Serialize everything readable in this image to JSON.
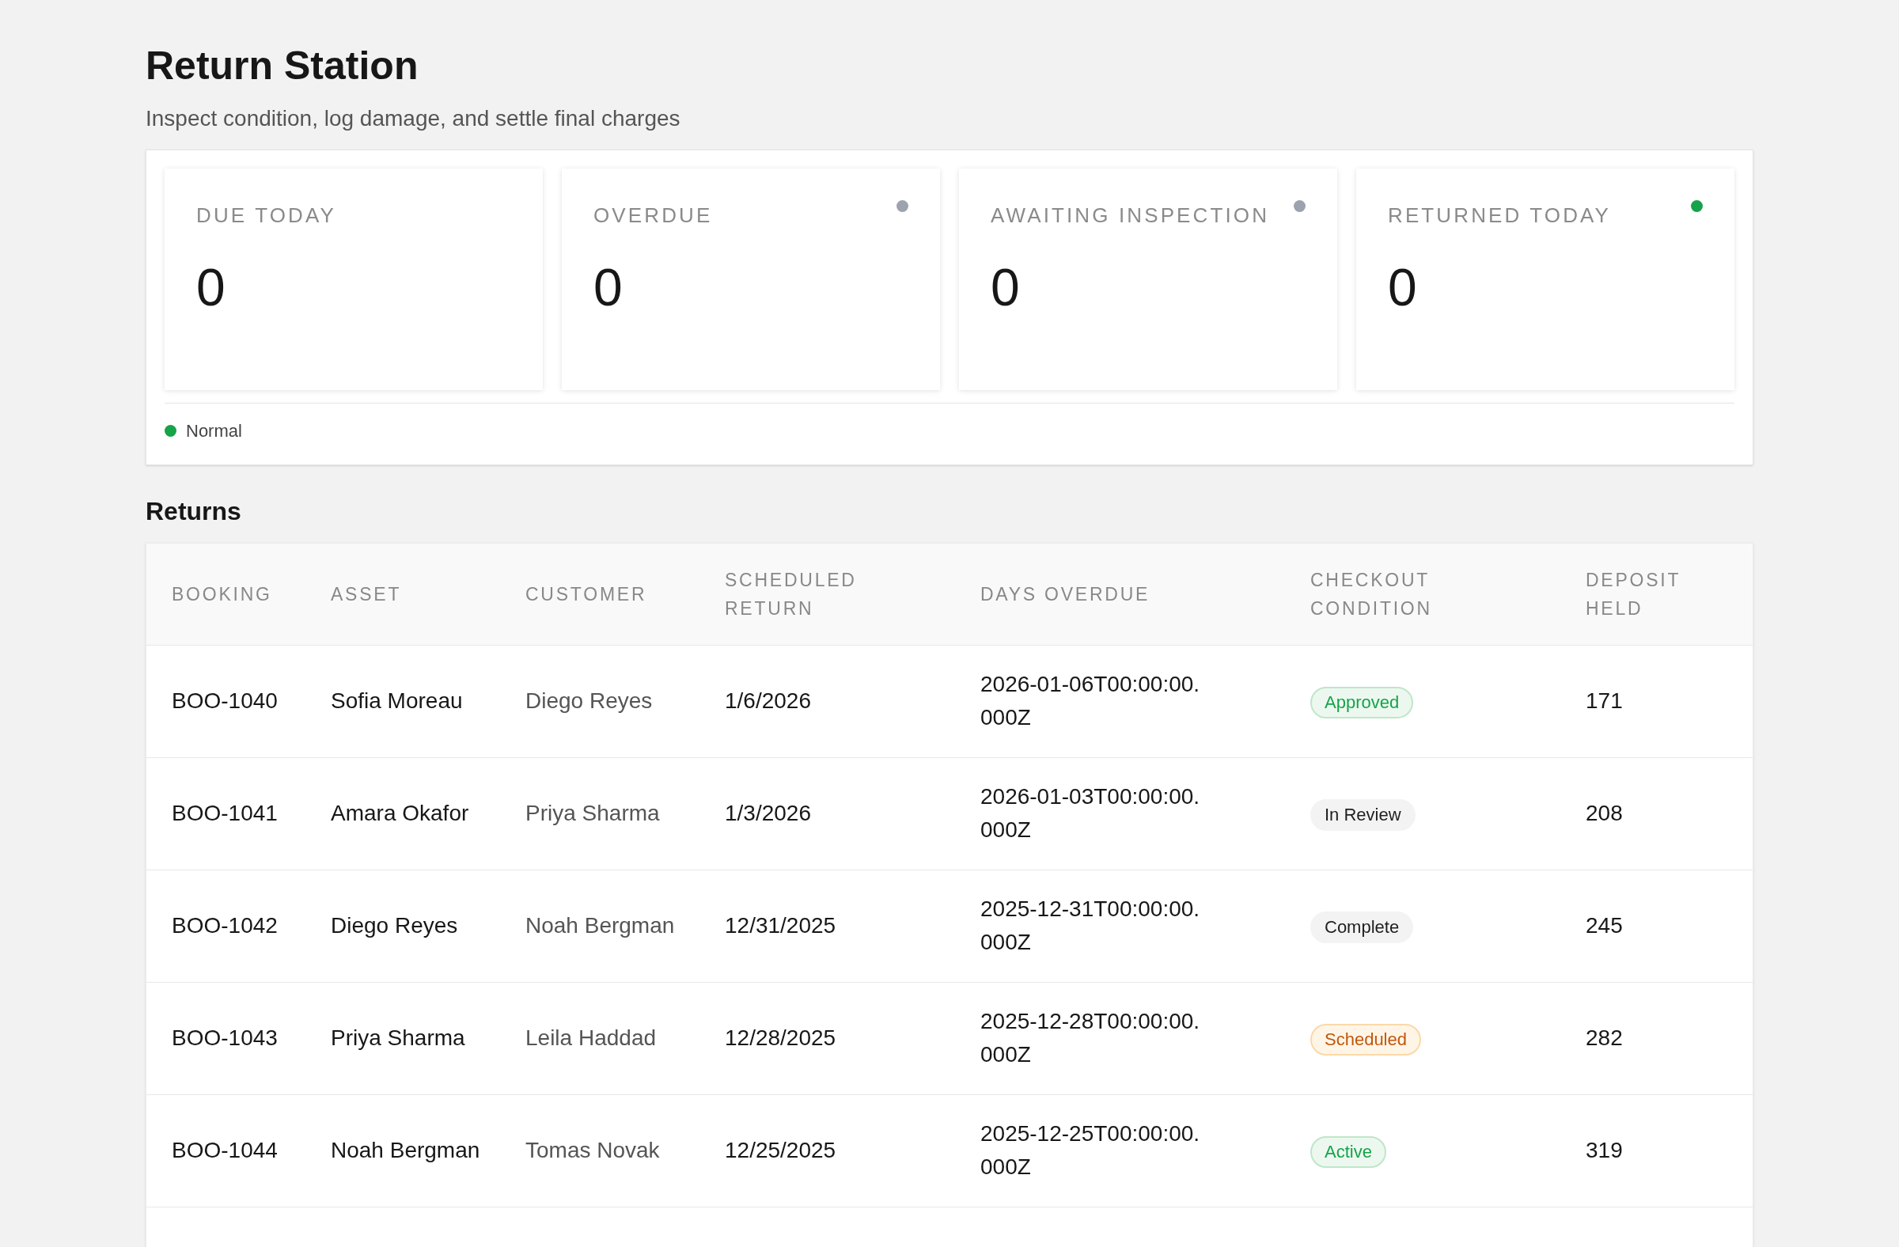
{
  "header": {
    "title": "Return Station",
    "subtitle": "Inspect condition, log damage, and settle final charges"
  },
  "stats": [
    {
      "label": "DUE TODAY",
      "value": "0"
    },
    {
      "label": "OVERDUE",
      "value": "0",
      "color": "#9ca3af"
    },
    {
      "label": "AWAITING INSPECTION",
      "value": "0",
      "color": "#9ca3af"
    },
    {
      "label": "RETURNED TODAY",
      "value": "0",
      "color": "#16a34a"
    }
  ],
  "legend": {
    "label": "Normal",
    "color": "#16a34a"
  },
  "returns": {
    "title": "Returns",
    "columns": [
      "BOOKING",
      "ASSET",
      "CUSTOMER",
      "SCHEDULED RETURN",
      "DAYS OVERDUE",
      "CHECKOUT CONDITION",
      "DEPOSIT HELD"
    ],
    "rows": [
      {
        "booking": "BOO-1040",
        "asset": "Sofia Moreau",
        "customer": "Diego Reyes",
        "scheduled": "1/6/2026",
        "days_overdue": "2026-01-06T00:00:00.000Z",
        "condition": {
          "label": "Approved",
          "kind": "success"
        },
        "deposit": "171"
      },
      {
        "booking": "BOO-1041",
        "asset": "Amara Okafor",
        "customer": "Priya Sharma",
        "scheduled": "1/3/2026",
        "days_overdue": "2026-01-03T00:00:00.000Z",
        "condition": {
          "label": "In Review",
          "kind": "neutral"
        },
        "deposit": "208"
      },
      {
        "booking": "BOO-1042",
        "asset": "Diego Reyes",
        "customer": "Noah Bergman",
        "scheduled": "12/31/2025",
        "days_overdue": "2025-12-31T00:00:00.000Z",
        "condition": {
          "label": "Complete",
          "kind": "neutral"
        },
        "deposit": "245"
      },
      {
        "booking": "BOO-1043",
        "asset": "Priya Sharma",
        "customer": "Leila Haddad",
        "scheduled": "12/28/2025",
        "days_overdue": "2025-12-28T00:00:00.000Z",
        "condition": {
          "label": "Scheduled",
          "kind": "warning"
        },
        "deposit": "282"
      },
      {
        "booking": "BOO-1044",
        "asset": "Noah Bergman",
        "customer": "Tomas Novak",
        "scheduled": "12/25/2025",
        "days_overdue": "2025-12-25T00:00:00.000Z",
        "condition": {
          "label": "Active",
          "kind": "success"
        },
        "deposit": "319"
      }
    ]
  }
}
